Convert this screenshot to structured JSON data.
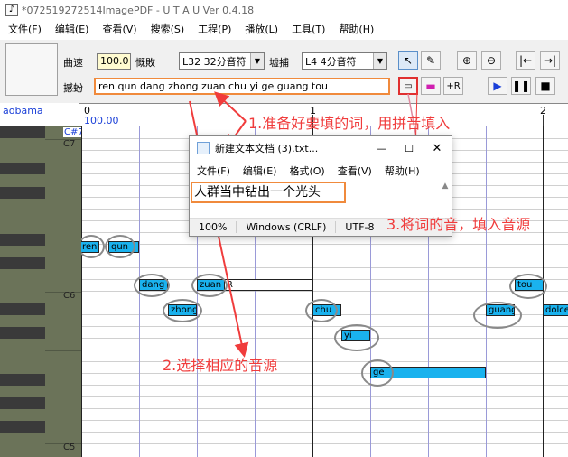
{
  "window": {
    "title": "*072519272514ImagePDF - U T A U  Ver 0.4.18"
  },
  "menu": [
    "文件(F)",
    "编辑(E)",
    "查看(V)",
    "搜索(S)",
    "工程(P)",
    "播放(L)",
    "工具(T)",
    "帮助(H)"
  ],
  "toolbar": {
    "tempo_label": "曲速",
    "tempo_value": "100.0",
    "tempo_unit": "慨敗",
    "quantize_value": "L32 32分音符",
    "insert_label": "墟捕",
    "insert_value": "L4  4分音符",
    "lyric_label": "撼蚡",
    "lyric_value": "ren qun dang zhong zuan chu yi ge guang tou"
  },
  "ruler": {
    "singer": "aobama",
    "marks": [
      "0",
      "1",
      "2"
    ],
    "tempo_mark": "100.00"
  },
  "piano": {
    "labels": [
      "C#7",
      "C7",
      "C6",
      "C5"
    ]
  },
  "notes": [
    {
      "lyric": "ren",
      "style": "filled"
    },
    {
      "lyric": "qun",
      "style": "filled"
    },
    {
      "lyric": "dang",
      "style": "filled"
    },
    {
      "lyric": "zuan",
      "style": "filled"
    },
    {
      "lyric": "R",
      "style": "empty"
    },
    {
      "lyric": "tou",
      "style": "filled"
    },
    {
      "lyric": "zhong",
      "style": "filled"
    },
    {
      "lyric": "chu",
      "style": "filled"
    },
    {
      "lyric": "guang",
      "style": "filled"
    },
    {
      "lyric": "dolce",
      "style": "filled"
    },
    {
      "lyric": "yi",
      "style": "filled"
    },
    {
      "lyric": "ge",
      "style": "filled"
    }
  ],
  "notepad": {
    "title": "新建文本文档 (3).txt...",
    "menu": [
      "文件(F)",
      "编辑(E)",
      "格式(O)",
      "查看(V)",
      "帮助(H)"
    ],
    "content": "人群当中钻出一个光头",
    "status": {
      "zoom": "100%",
      "eol": "Windows (CRLF)",
      "encoding": "UTF-8"
    }
  },
  "annotations": {
    "step1": "1.准备好要填的词，用拼音填入",
    "step2": "2.选择相应的音源",
    "step3": "3.将词的音，填入音源"
  },
  "colors": {
    "note_fill": "#1ab2ee",
    "annotation": "#f03c3c",
    "highlight_box": "#f08a3c"
  }
}
